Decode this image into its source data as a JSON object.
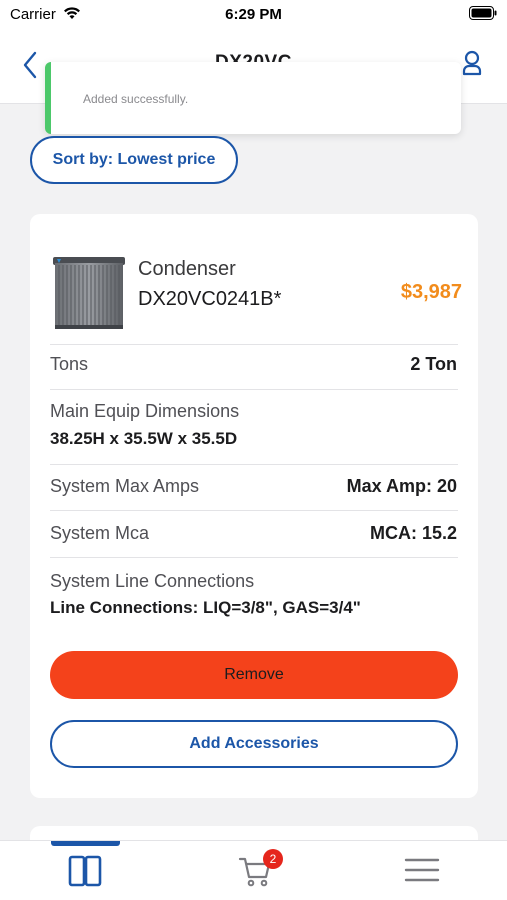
{
  "status_bar": {
    "carrier": "Carrier",
    "time": "6:29 PM"
  },
  "nav": {
    "title": "DX20VC"
  },
  "toast": {
    "message": "Added successfully.",
    "accent_color": "#4cc86a"
  },
  "sort": {
    "label": "Sort by: Lowest price"
  },
  "product": {
    "type": "Condenser",
    "model": "DX20VC0241B*",
    "price": "$3,987",
    "specs": [
      {
        "label": "Tons",
        "value": "2 Ton",
        "layout": "inline"
      },
      {
        "label": "Main Equip Dimensions",
        "value": "38.25H x 35.5W x 35.5D",
        "layout": "stacked"
      },
      {
        "label": "System Max Amps",
        "value": "Max Amp: 20",
        "layout": "inline"
      },
      {
        "label": "System Mca",
        "value": "MCA: 15.2",
        "layout": "inline"
      },
      {
        "label": "System Line Connections",
        "value": "Line Connections: LIQ=3/8\", GAS=3/4\"",
        "layout": "stacked"
      }
    ],
    "remove_label": "Remove",
    "accessories_label": "Add Accessories"
  },
  "tab_bar": {
    "items": [
      {
        "icon": "catalog-icon",
        "selected": true
      },
      {
        "icon": "cart-icon",
        "badge": "2"
      },
      {
        "icon": "menu-icon"
      }
    ]
  },
  "colors": {
    "brand_blue": "#1c56a8",
    "price_orange": "#f28c1c",
    "remove_red": "#f4421b",
    "badge_red": "#e5261c"
  }
}
